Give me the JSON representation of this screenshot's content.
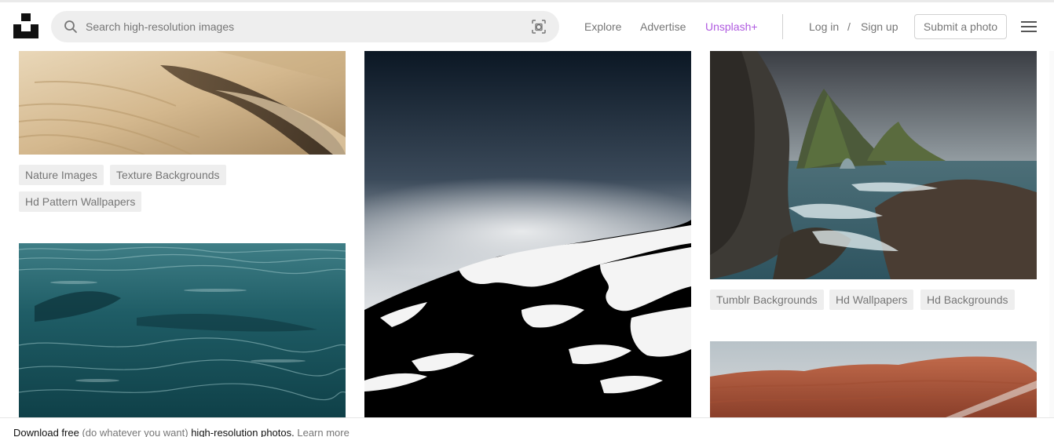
{
  "header": {
    "search_placeholder": "Search high-resolution images",
    "nav": {
      "explore": "Explore",
      "advertise": "Advertise",
      "unsplash_plus": "Unsplash+",
      "login": "Log in",
      "separator": "/",
      "signup": "Sign up",
      "submit": "Submit a photo"
    },
    "icons": {
      "logo": "unsplash-logo",
      "search": "search-icon",
      "visual_search": "visual-search-icon",
      "menu": "hamburger-menu-icon"
    },
    "colors": {
      "unsplash_plus": "#b05ae0"
    }
  },
  "photos": {
    "sand_dune": {
      "subject": "sand-dune",
      "tags": [
        "Nature Images",
        "Texture Backgrounds",
        "Hd Pattern Wallpapers"
      ]
    },
    "snow_mountain": {
      "subject": "snowy-mountain-in-fog"
    },
    "sea_cliffs": {
      "subject": "sea-arch-cliffs",
      "tags": [
        "Tumblr Backgrounds",
        "Hd Wallpapers",
        "Hd Backgrounds"
      ]
    },
    "ocean": {
      "subject": "ocean-water"
    },
    "red_rock": {
      "subject": "red-rock-formation"
    }
  },
  "banner": {
    "prefix": "Download free",
    "middle": "(do whatever you want)",
    "suffix": "high-resolution photos.",
    "link": "Learn more"
  }
}
